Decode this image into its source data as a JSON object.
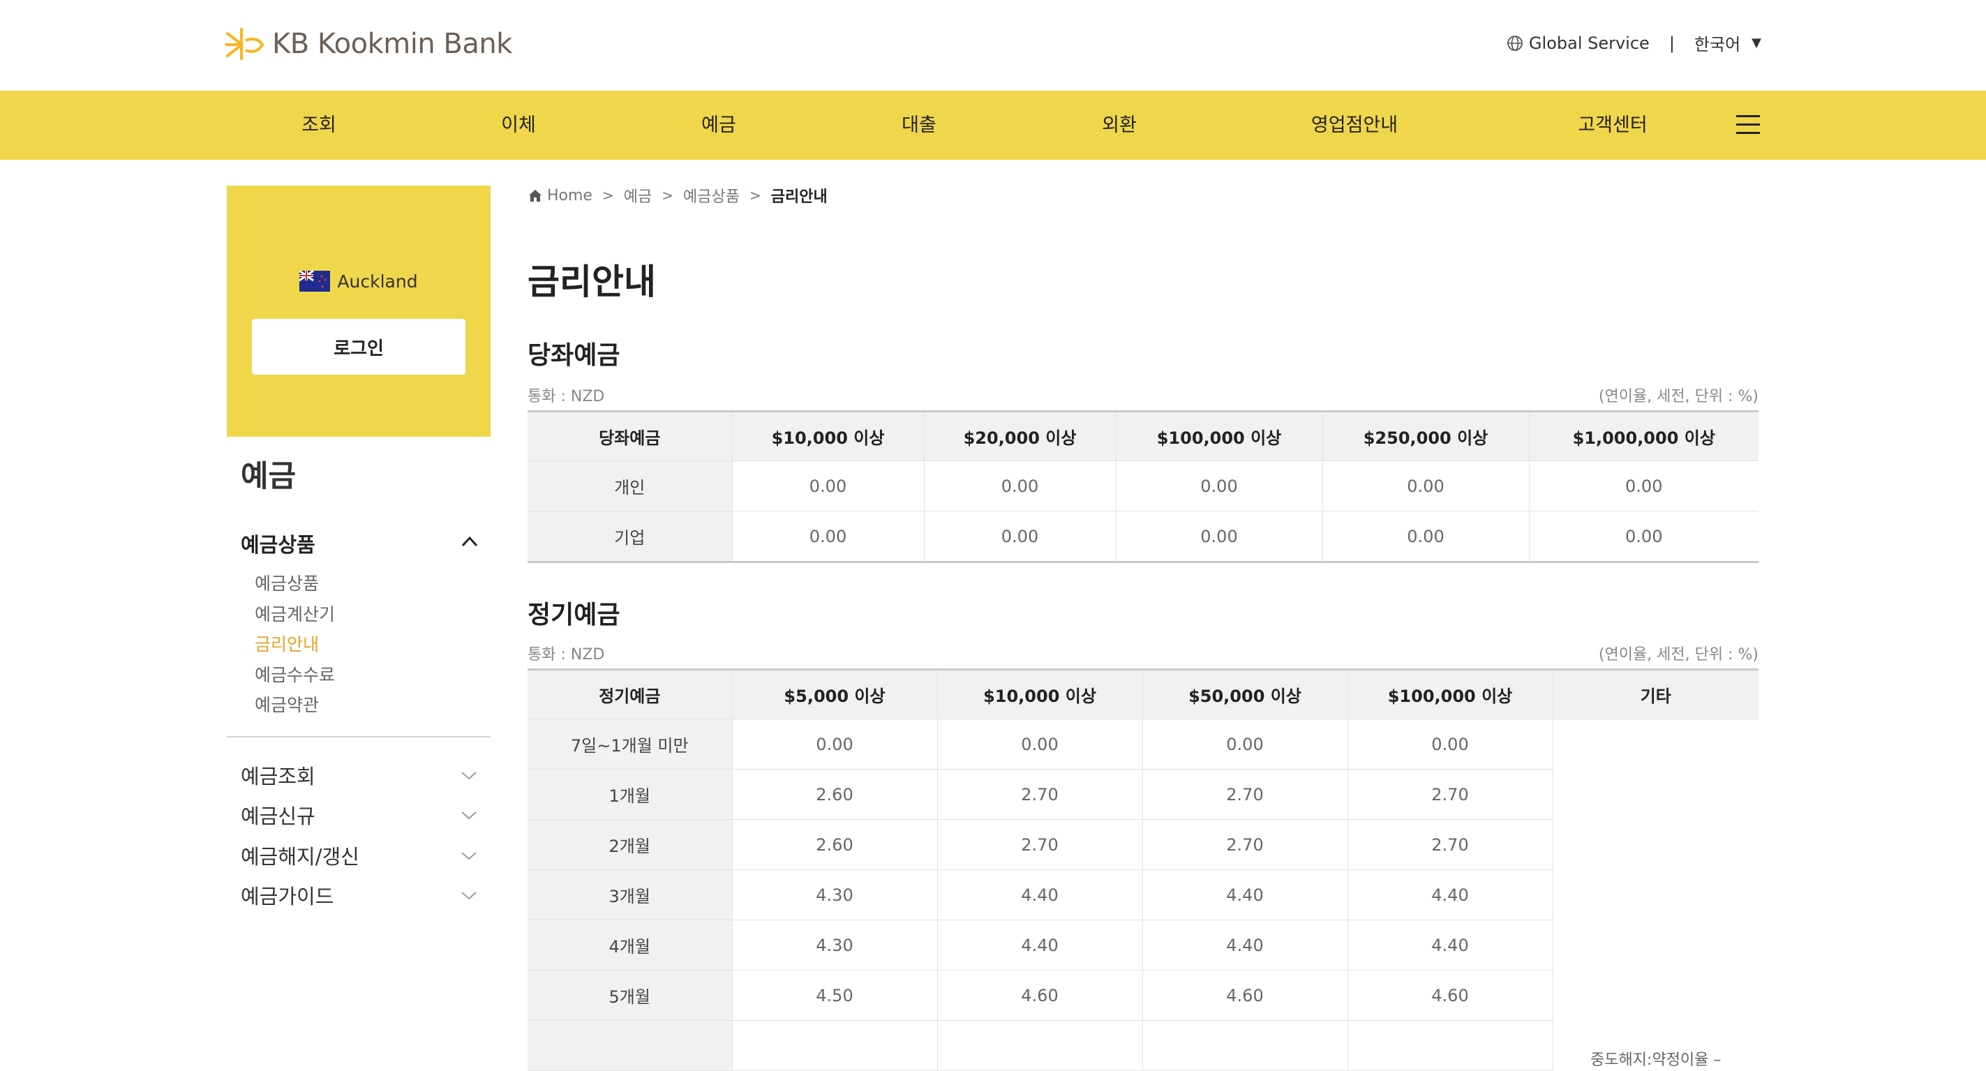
{
  "header": {
    "logo_text": "KB Kookmin Bank",
    "global_service": "Global Service",
    "language": "한국어",
    "nav": [
      "조회",
      "이체",
      "예금",
      "대출",
      "외환",
      "영업점안내",
      "고객센터"
    ]
  },
  "sidebar": {
    "branch": "Auckland",
    "login_label": "로그인",
    "section_title": "예금",
    "group_label": "예금상품",
    "sub_items": [
      {
        "label": "예금상품"
      },
      {
        "label": "예금계산기"
      },
      {
        "label": "금리안내"
      },
      {
        "label": "예금수수료"
      },
      {
        "label": "예금약관"
      }
    ],
    "active_sub": "금리안내",
    "menu": [
      "예금조회",
      "예금신규",
      "예금해지/갱신",
      "예금가이드"
    ]
  },
  "breadcrumb": {
    "home": "Home",
    "level1": "예금",
    "level2": "예금상품",
    "current": "금리안내"
  },
  "page_title": "금리안내",
  "checking": {
    "title": "당좌예금",
    "currency": "통화 : NZD",
    "unit": "(연이율, 세전, 단위 : %)",
    "headers": [
      "당좌예금",
      "$10,000 이상",
      "$20,000 이상",
      "$100,000 이상",
      "$250,000 이상",
      "$1,000,000 이상"
    ],
    "rows": [
      {
        "label": "개인",
        "values": [
          "0.00",
          "0.00",
          "0.00",
          "0.00",
          "0.00"
        ]
      },
      {
        "label": "기업",
        "values": [
          "0.00",
          "0.00",
          "0.00",
          "0.00",
          "0.00"
        ]
      }
    ]
  },
  "term": {
    "title": "정기예금",
    "currency": "통화 : NZD",
    "unit": "(연이율, 세전, 단위 : %)",
    "headers": [
      "정기예금",
      "$5,000 이상",
      "$10,000 이상",
      "$50,000 이상",
      "$100,000 이상",
      "기타"
    ],
    "rows": [
      {
        "label": "7일~1개월 미만",
        "values": [
          "0.00",
          "0.00",
          "0.00",
          "0.00"
        ]
      },
      {
        "label": "1개월",
        "values": [
          "2.60",
          "2.70",
          "2.70",
          "2.70"
        ]
      },
      {
        "label": "2개월",
        "values": [
          "2.60",
          "2.70",
          "2.70",
          "2.70"
        ]
      },
      {
        "label": "3개월",
        "values": [
          "4.30",
          "4.40",
          "4.40",
          "4.40"
        ]
      },
      {
        "label": "4개월",
        "values": [
          "4.30",
          "4.40",
          "4.40",
          "4.40"
        ]
      },
      {
        "label": "5개월",
        "values": [
          "4.50",
          "4.60",
          "4.60",
          "4.60"
        ]
      }
    ],
    "other_note": "중도해지:약정이율 –"
  },
  "colors": {
    "brand_yellow": "#f0d64b",
    "active_orange": "#e6a325",
    "logo_star": "#f5b71f",
    "logo_text": "#6b6054"
  },
  "icons": {
    "logo": "kb-star-logo",
    "globe": "globe-icon",
    "menu": "hamburger-menu-icon",
    "home": "home-icon",
    "flag": "new-zealand-flag"
  }
}
